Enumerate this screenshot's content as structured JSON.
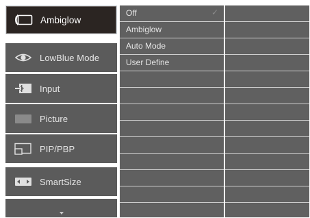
{
  "menu": {
    "items": [
      {
        "id": "ambiglow",
        "label": "Ambiglow",
        "icon": "ambiglow-icon",
        "selected": true
      },
      {
        "id": "lowblue",
        "label": "LowBlue Mode",
        "icon": "eye-icon",
        "selected": false
      },
      {
        "id": "input",
        "label": "Input",
        "icon": "input-arrow-icon",
        "selected": false
      },
      {
        "id": "picture",
        "label": "Picture",
        "icon": "picture-icon",
        "selected": false
      },
      {
        "id": "pipbp",
        "label": "PIP/PBP",
        "icon": "pip-icon",
        "selected": false
      },
      {
        "id": "smartsize",
        "label": "SmartSize",
        "icon": "smartsize-icon",
        "selected": false
      }
    ],
    "more_icon": "chevron-down-icon"
  },
  "submenu": {
    "options": [
      {
        "label": "Off",
        "checked": true
      },
      {
        "label": "Ambiglow",
        "checked": false
      },
      {
        "label": "Auto Mode",
        "checked": false
      },
      {
        "label": "User Define",
        "checked": false
      }
    ],
    "check_glyph": "✓"
  },
  "colors": {
    "panel": "#5b5b5b",
    "selected": "#2b2522",
    "background": "#ffffff",
    "text": "#e7e7e7"
  }
}
